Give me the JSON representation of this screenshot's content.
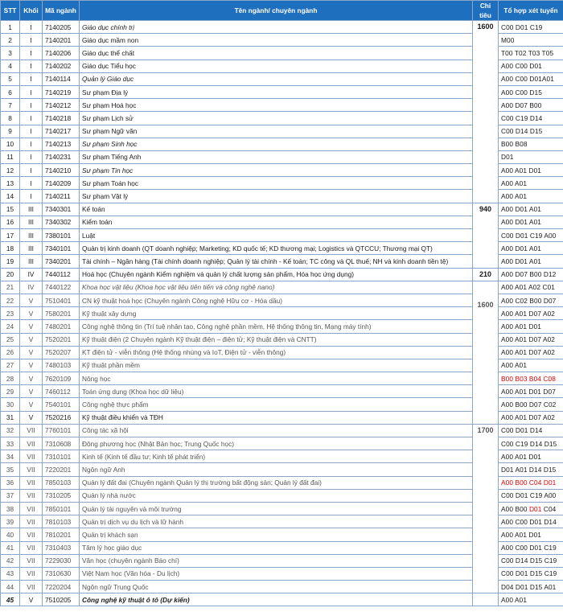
{
  "header": {
    "stt": "STT",
    "khoi": "Khối",
    "ma_nganh": "Mã ngành",
    "ten_nganh": "Tên ngành/ chuyên ngành",
    "chi_tieu_1": "Chỉ",
    "chi_tieu_2": "tiêu",
    "to_hop": "Tổ hợp xét tuyển"
  },
  "quotas": {
    "q1": "1600",
    "q2": "940",
    "q3": "210",
    "q4": "1600",
    "q5": "1700"
  },
  "rows": [
    {
      "stt": "1",
      "khoi": "I",
      "ma": "7140205",
      "ten": "Giáo dục chính trị",
      "tohop": "C00 D01 C19"
    },
    {
      "stt": "2",
      "khoi": "I",
      "ma": "7140201",
      "ten": "Giáo dục mầm non",
      "tohop": "M00"
    },
    {
      "stt": "3",
      "khoi": "I",
      "ma": "7140206",
      "ten": "Giáo dục thể chất",
      "tohop": "T00 T02 T03 T05"
    },
    {
      "stt": "4",
      "khoi": "I",
      "ma": "7140202",
      "ten": "Giáo dục Tiểu học",
      "tohop": "A00 C00 D01"
    },
    {
      "stt": "5",
      "khoi": "I",
      "ma": "7140114",
      "ten": "Quản lý Giáo dục",
      "tohop": "A00 C00 D01A01"
    },
    {
      "stt": "6",
      "khoi": "I",
      "ma": "7140219",
      "ten": "Sư phạm Địa lý",
      "tohop": "A00 C00 D15"
    },
    {
      "stt": "7",
      "khoi": "I",
      "ma": "7140212",
      "ten": "Sư phạm Hoá học",
      "tohop": "A00 D07 B00"
    },
    {
      "stt": "8",
      "khoi": "I",
      "ma": "7140218",
      "ten": "Sư phạm Lịch sử",
      "tohop": "C00 C19 D14"
    },
    {
      "stt": "9",
      "khoi": "I",
      "ma": "7140217",
      "ten": "Sư phạm Ngữ văn",
      "tohop": "C00 D14 D15"
    },
    {
      "stt": "10",
      "khoi": "I",
      "ma": "7140213",
      "ten": "Sư phạm Sinh học",
      "tohop": "B00 B08"
    },
    {
      "stt": "11",
      "khoi": "I",
      "ma": "7140231",
      "ten": "Sư phạm Tiếng Anh",
      "tohop": "D01"
    },
    {
      "stt": "12",
      "khoi": "I",
      "ma": "7140210",
      "ten": "Sư phạm Tin học",
      "tohop": "A00 A01 D01"
    },
    {
      "stt": "13",
      "khoi": "I",
      "ma": "7140209",
      "ten": "Sư phạm Toán học",
      "tohop": "A00 A01"
    },
    {
      "stt": "14",
      "khoi": "I",
      "ma": "7140211",
      "ten": "Sư phạm Vật lý",
      "tohop": "A00 A01"
    },
    {
      "stt": "15",
      "khoi": "III",
      "ma": "7340301",
      "ten": "Kế toán",
      "tohop": "A00 D01 A01"
    },
    {
      "stt": "16",
      "khoi": "III",
      "ma": "7340302",
      "ten": "Kiểm toán",
      "tohop": "A00 D01 A01"
    },
    {
      "stt": "17",
      "khoi": "III",
      "ma": "7380101",
      "ten": "Luật",
      "tohop": "C00 D01 C19 A00"
    },
    {
      "stt": "18",
      "khoi": "III",
      "ma": "7340101",
      "ten": "Quản trị kinh doanh (QT doanh nghiệp; Marketing; KD quốc tế; KD thương mại; Logistics và QTCCU; Thương mại QT)",
      "tohop": "A00 D01 A01"
    },
    {
      "stt": "19",
      "khoi": "III",
      "ma": "7340201",
      "ten": "Tài chính – Ngân hàng (Tài chính doanh nghiệp; Quản lý tài chính - Kế toán; TC công và QL thuế; NH và kinh doanh tiền tệ)",
      "tohop": "A00 D01 A01"
    },
    {
      "stt": "20",
      "khoi": "IV",
      "ma": "7440112",
      "ten": "Hoá học (Chuyên ngành Kiểm nghiệm và quản lý chất lượng sản phẩm, Hóa học ứng dụng)",
      "tohop": "A00 D07 B00 D12"
    },
    {
      "stt": "21",
      "khoi": "IV",
      "ma": "7440122",
      "ten": "Khoa học vật liệu (Khoa học vật liệu tiên tiến và công nghệ nano)",
      "tohop": "A00 A01 A02 C01"
    },
    {
      "stt": "22",
      "khoi": "V",
      "ma": "7510401",
      "ten": "CN kỹ thuật hoá học (Chuyên ngành Công nghệ Hữu cơ - Hóa dầu)",
      "tohop": "A00 C02 B00 D07"
    },
    {
      "stt": "23",
      "khoi": "V",
      "ma": "7580201",
      "ten": "Kỹ thuật xây dựng",
      "tohop": "A00 A01 D07 A02"
    },
    {
      "stt": "24",
      "khoi": "V",
      "ma": "7480201",
      "ten": "Công nghệ thông tin (Trí tuệ nhân tạo, Công nghệ phần mềm, Hệ thống thông tin, Mạng máy tính)",
      "tohop": "A00 A01 D01"
    },
    {
      "stt": "25",
      "khoi": "V",
      "ma": "7520201",
      "ten": "Kỹ thuật điện (2 Chuyên ngành Kỹ thuật điện – điện tử; Kỹ thuật điện và CNTT)",
      "tohop": "A00 A01 D07 A02"
    },
    {
      "stt": "26",
      "khoi": "V",
      "ma": "7520207",
      "ten": "KT điện tử - viễn thông (Hệ thống nhúng và IoT, Điện tử - viễn thông)",
      "tohop": "A00 A01 D07 A02"
    },
    {
      "stt": "27",
      "khoi": "V",
      "ma": "7480103",
      "ten": "Kỹ thuật phần mềm",
      "tohop": "A00 A01"
    },
    {
      "stt": "28",
      "khoi": "V",
      "ma": "7620109",
      "ten": "Nông học",
      "tohop": "B00 B03 B04 C08"
    },
    {
      "stt": "29",
      "khoi": "V",
      "ma": "7460112",
      "ten": "Toán ứng dụng (Khoa học dữ liệu)",
      "tohop": "A00 A01 D01 D07"
    },
    {
      "stt": "30",
      "khoi": "V",
      "ma": "7540101",
      "ten": "Công nghệ thực phẩm",
      "tohop": "A00 B00 D07 C02"
    },
    {
      "stt": "31",
      "khoi": "V",
      "ma": "7520216",
      "ten": "Kỹ thuật điều khiển và TĐH",
      "tohop": "A00 A01 D07 A02"
    },
    {
      "stt": "32",
      "khoi": "VII",
      "ma": "7760101",
      "ten": "Công tác xã hội",
      "tohop": "C00 D01 D14"
    },
    {
      "stt": "33",
      "khoi": "VII",
      "ma": "7310608",
      "ten": "Đông phương học (Nhật Bản học; Trung Quốc học)",
      "tohop": "C00 C19 D14 D15"
    },
    {
      "stt": "34",
      "khoi": "VII",
      "ma": "7310101",
      "ten": "Kinh tế (Kinh tế đầu tư; Kinh tế phát triển)",
      "tohop": "A00 A01 D01"
    },
    {
      "stt": "35",
      "khoi": "VII",
      "ma": "7220201",
      "ten": "Ngôn ngữ Anh",
      "tohop": "D01 A01 D14 D15"
    },
    {
      "stt": "36",
      "khoi": "VII",
      "ma": "7850103",
      "ten": "Quản lý đất đai (Chuyên ngành Quản lý thị trường bất động sản; Quản lý đất đai)",
      "tohop": "A00 B00 C04 D01"
    },
    {
      "stt": "37",
      "khoi": "VII",
      "ma": "7310205",
      "ten": "Quản lý nhà nước",
      "tohop": "C00 D01 C19 A00"
    },
    {
      "stt": "38",
      "khoi": "VII",
      "ma": "7850101",
      "ten": "Quản lý tài nguyên và môi trường",
      "tohop_a": "A00 B00 ",
      "tohop_b": "D01",
      "tohop_c": " C04"
    },
    {
      "stt": "39",
      "khoi": "VII",
      "ma": "7810103",
      "ten": "Quản trị dịch vụ du lịch và lữ hành",
      "tohop": "A00 C00 D01 D14"
    },
    {
      "stt": "40",
      "khoi": "VII",
      "ma": "7810201",
      "ten": "Quản trị khách sạn",
      "tohop": "A00 A01 D01"
    },
    {
      "stt": "41",
      "khoi": "VII",
      "ma": "7310403",
      "ten": "Tâm lý học giáo dục",
      "tohop": "A00 C00 D01 C19"
    },
    {
      "stt": "42",
      "khoi": "VII",
      "ma": "7229030",
      "ten": "Văn học (chuyên ngành Báo chí)",
      "tohop": "C00 D14 D15 C19"
    },
    {
      "stt": "43",
      "khoi": "VII",
      "ma": "7310630",
      "ten": "Việt Nam học (Văn hóa - Du lịch)",
      "tohop": "C00 D01 D15 C19"
    },
    {
      "stt": "44",
      "khoi": "VII",
      "ma": "7220204",
      "ten": "Ngôn ngữ Trung Quốc",
      "tohop": "D04 D01 D15 A01"
    },
    {
      "stt": "45",
      "khoi": "V",
      "ma": "7510205",
      "ten": "Công nghệ kỹ thuật ô tô (Dự kiến)",
      "tohop": "A00 A01"
    }
  ]
}
